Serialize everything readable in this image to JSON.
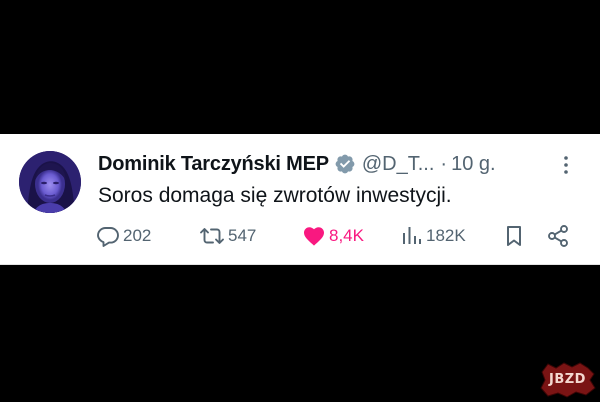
{
  "tweet": {
    "author": {
      "name": "Dominik Tarczyński MEP",
      "handle": "@D_T...",
      "verified": true
    },
    "separator": "·",
    "time": "10 g.",
    "text": "Soros domaga się zwrotów inwestycji.",
    "stats": {
      "replies": "202",
      "retweets": "547",
      "likes": "8,4K",
      "views": "182K"
    },
    "liked": true
  },
  "colors": {
    "background": "#000000",
    "card": "#ffffff",
    "text_primary": "#0f1419",
    "text_secondary": "#536471",
    "verified": "#829aab",
    "like": "#f91880"
  },
  "icons": {
    "reply": "reply-icon",
    "retweet": "retweet-icon",
    "like": "heart-icon",
    "views": "views-icon",
    "bookmark": "bookmark-icon",
    "share": "share-icon",
    "more": "more-icon",
    "verified": "verified-badge-icon"
  },
  "watermark": {
    "text": "JBZD"
  }
}
